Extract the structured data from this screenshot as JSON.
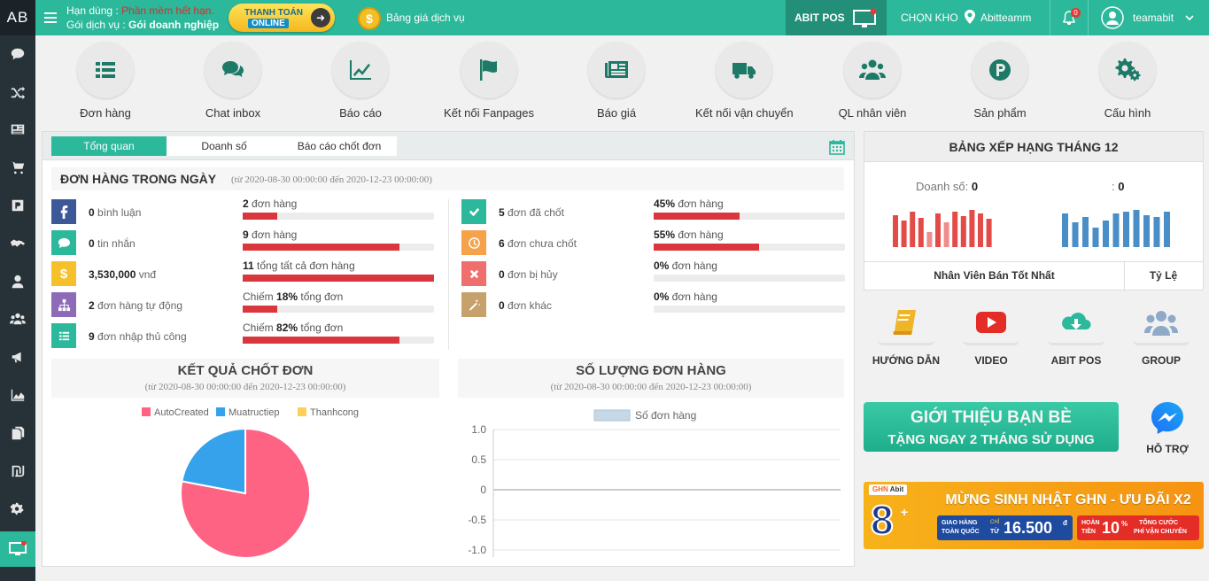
{
  "sidebar": {
    "logo": "AB"
  },
  "header": {
    "expire_label": "Hạn dùng : ",
    "expire_value": "Phần mềm hết hạn.",
    "plan_label": "Gói dịch vụ : ",
    "plan_value": "Gói doanh nghiệp",
    "pay_line1": "THANH TOÁN",
    "pay_line2": "ONLINE",
    "price_link": "Bảng giá dịch vụ",
    "pos_label": "ABIT POS",
    "warehouse_label": "CHỌN KHO",
    "warehouse_value": "Abitteamm",
    "notif_count": "0",
    "username": "teamabit"
  },
  "features": [
    {
      "label": "Đơn hàng",
      "icon": "list-icon"
    },
    {
      "label": "Chat inbox",
      "icon": "chat-icon"
    },
    {
      "label": "Báo cáo",
      "icon": "chart-icon"
    },
    {
      "label": "Kết nối Fanpages",
      "icon": "flag-icon"
    },
    {
      "label": "Báo giá",
      "icon": "newspaper-icon"
    },
    {
      "label": "Kết nối vận chuyển",
      "icon": "truck-icon"
    },
    {
      "label": "QL nhân viên",
      "icon": "users-icon"
    },
    {
      "label": "Sản phẩm",
      "icon": "product-icon"
    },
    {
      "label": "Cấu hình",
      "icon": "gears-icon"
    }
  ],
  "tabs": [
    "Tổng quan",
    "Doanh số",
    "Báo cáo chốt đơn"
  ],
  "orders": {
    "title": "ĐƠN HÀNG TRONG NGÀY",
    "range": "(từ 2020-08-30 00:00:00 đến 2020-12-23 00:00:00)",
    "left": [
      {
        "num": "0",
        "text": " bình luận",
        "bar_num": "2",
        "bar_text": " đơn hàng",
        "pct": 0.18,
        "color": "#3b5998",
        "icon": "facebook-icon"
      },
      {
        "num": "0",
        "text": " tin nhắn",
        "bar_num": "9",
        "bar_text": " đơn hàng",
        "pct": 0.82,
        "color": "#2cb89a",
        "icon": "chat-icon"
      },
      {
        "num": "3,530,000",
        "text": " vnđ",
        "bar_num": "11",
        "bar_text": " tổng tất cả đơn hàng",
        "pct": 1.0,
        "color": "#f5c02a",
        "icon": "dollar-icon"
      },
      {
        "num": "2",
        "text": " đơn hàng tự động",
        "bar_pre": "Chiếm ",
        "bar_num": "18%",
        "bar_text": " tổng đơn",
        "pct": 0.18,
        "color": "#8e6bb8",
        "icon": "sitemap-icon"
      },
      {
        "num": "9",
        "text": " đơn nhập thủ công",
        "bar_pre": "Chiếm ",
        "bar_num": "82%",
        "bar_text": " tổng đơn",
        "pct": 0.82,
        "color": "#2cb89a",
        "icon": "list-icon"
      }
    ],
    "right": [
      {
        "num": "5",
        "text": " đơn đã chốt",
        "bar_num": "45%",
        "bar_text": " đơn hàng",
        "pct": 0.45,
        "color": "#2cb89a",
        "icon": "check-icon"
      },
      {
        "num": "6",
        "text": " đơn chưa chốt",
        "bar_num": "55%",
        "bar_text": " đơn hàng",
        "pct": 0.55,
        "color": "#f5a24a",
        "icon": "clock-icon"
      },
      {
        "num": "0",
        "text": " đơn bị hủy",
        "bar_num": "0%",
        "bar_text": " đơn hàng",
        "pct": 0,
        "color": "#ef6f6c",
        "icon": "close-icon"
      },
      {
        "num": "0",
        "text": " đơn khác",
        "bar_num": "0%",
        "bar_text": " đơn hàng",
        "pct": 0,
        "color": "#c7a16b",
        "icon": "wand-icon"
      }
    ]
  },
  "result": {
    "title": "KẾT QUẢ CHỐT ĐƠN",
    "range": "(từ 2020-08-30 00:00:00 đến 2020-12-23 00:00:00)"
  },
  "count": {
    "title": "SỐ LƯỢNG ĐƠN HÀNG",
    "range": "(từ 2020-08-30 00:00:00 đến 2020-12-23 00:00:00)"
  },
  "chart_data": [
    {
      "type": "pie",
      "legend": [
        "AutoCreated",
        "Muatructiep",
        "Thanhcong"
      ],
      "values": [
        78,
        22,
        0
      ],
      "colors": [
        "#ff6384",
        "#36a2eb",
        "#ffce56"
      ],
      "legend_position": "top"
    },
    {
      "type": "line",
      "series": [
        {
          "name": "Số đơn hàng",
          "values": []
        }
      ],
      "yticks": [
        "1.0",
        "0.5",
        "0",
        "-0.5",
        "-1.0"
      ],
      "ylim": [
        -1,
        1
      ],
      "grid": true,
      "legend_position": "top"
    }
  ],
  "ranking": {
    "title": "BẢNG XẾP HẠNG THÁNG 12",
    "sales_label": "Doanh số: ",
    "sales_value": "0",
    "right_label": ": ",
    "right_value": "0",
    "col1": "Nhân Viên Bán Tốt Nhất",
    "col2": "Tỷ Lệ"
  },
  "links": [
    {
      "label": "HƯỚNG DẪN",
      "icon": "book-icon"
    },
    {
      "label": "VIDEO",
      "icon": "youtube-icon"
    },
    {
      "label": "ABIT POS",
      "icon": "cloud-download-icon"
    },
    {
      "label": "GROUP",
      "icon": "group-icon"
    }
  ],
  "promo": {
    "line1": "GIỚI THIỆU BẠN BÈ",
    "line2": "TẶNG NGAY 2 THÁNG SỬ DỤNG"
  },
  "support": "HỖ TRỢ",
  "ghn": {
    "logo_ghn": "GHN",
    "logo_abit": "Abit",
    "title": "MỪNG SINH NHẬT GHN - ƯU ĐÃI X2",
    "eight": "8",
    "plus": "+",
    "b1a": "GIAO HÀNG",
    "b1b": "TOÀN QUỐC",
    "b1c": "CHỈ",
    "b1d": "TỪ",
    "b1e": "16.500",
    "b1f": "đ",
    "b2a": "HOÀN",
    "b2b": "TIỀN",
    "b2c": "10",
    "b2d": "%",
    "b2e": "TỔNG CƯỚC",
    "b2f": "PHÍ VẬN CHUYỂN"
  }
}
